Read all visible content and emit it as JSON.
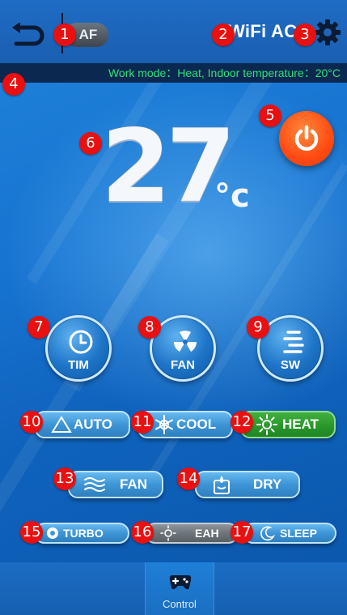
{
  "header": {
    "mode_pill": "AF",
    "device_name": "WiFi AC"
  },
  "status_bar": {
    "text": "Work mode：Heat,  Indoor temperature：20°C"
  },
  "main": {
    "temperature": "27",
    "unit": "°c"
  },
  "round_buttons": {
    "timer": "TIM",
    "fan": "FAN",
    "swing": "SW"
  },
  "modes": {
    "auto": "AUTO",
    "cool": "COOL",
    "heat": "HEAT",
    "fan": "FAN",
    "dry": "DRY"
  },
  "features": {
    "turbo": "TURBO",
    "eah": "EAH",
    "sleep": "SLEEP"
  },
  "markers": [
    "1",
    "2",
    "3",
    "4",
    "5",
    "6",
    "7",
    "8",
    "9",
    "10",
    "11",
    "12",
    "13",
    "14",
    "15",
    "16",
    "17"
  ],
  "bottom_nav": {
    "control": "Control"
  },
  "colors": {
    "power": "#ff4a12",
    "active_mode": "#2c9a2c",
    "status_text": "#2fe07a",
    "marker": "#e81010"
  }
}
